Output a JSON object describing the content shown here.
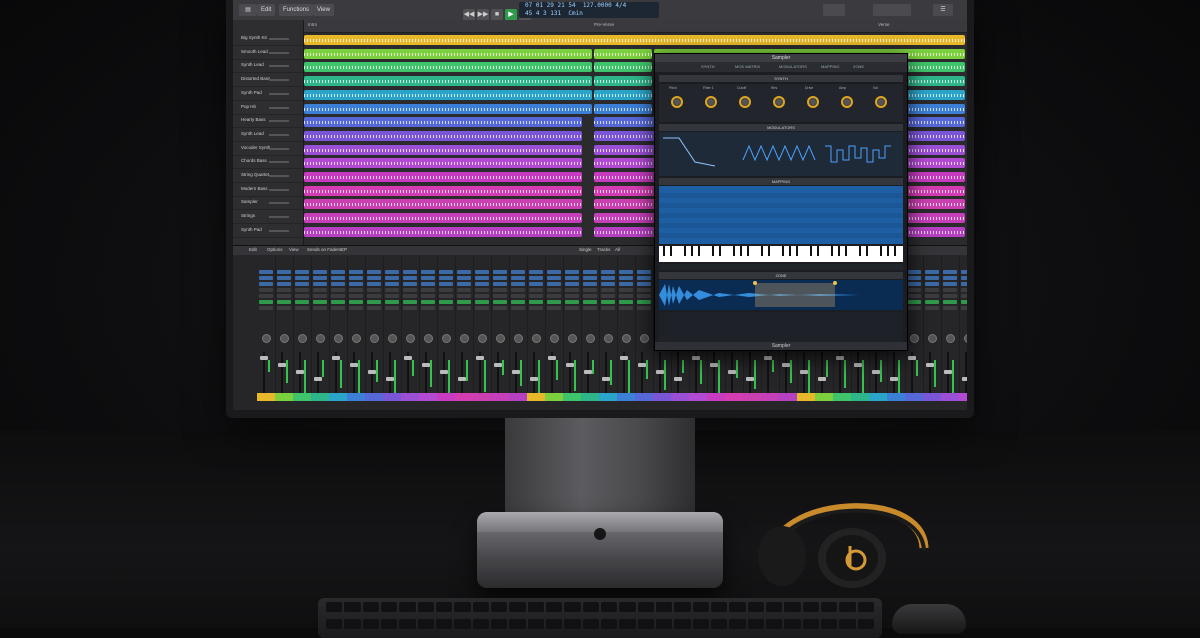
{
  "app": {
    "toolbar_left": [
      "Edit",
      "Functions",
      "View"
    ],
    "lcd_line1": "07 01 29 21 54",
    "lcd_line2": "45 4 3 131",
    "lcd_tempo": "127.0000",
    "lcd_sig": "4/4",
    "lcd_key": "Cmin",
    "transport_icons": [
      "rewind-icon",
      "forward-icon",
      "stop-icon",
      "play-icon",
      "record-icon",
      "cycle-icon"
    ]
  },
  "ruler": {
    "markers": [
      "Intro",
      "Pre-Verse",
      "Verse"
    ]
  },
  "tracks": [
    {
      "name": "Big Synth Kit",
      "color": "#e6b82a"
    },
    {
      "name": "Smooth Lead",
      "color": "#7ccf3d"
    },
    {
      "name": "Synth Lead",
      "color": "#3fc36b"
    },
    {
      "name": "Distorted Bass",
      "color": "#2fb58a"
    },
    {
      "name": "Synth Pad",
      "color": "#2aa4c9"
    },
    {
      "name": "Pop Hit",
      "color": "#3c7fd6"
    },
    {
      "name": "Hearty Bass",
      "color": "#5668d8"
    },
    {
      "name": "Synth Lead",
      "color": "#7a55d6"
    },
    {
      "name": "Vocoder Synth",
      "color": "#9b4fd4"
    },
    {
      "name": "Chords Bass",
      "color": "#b24ad3"
    },
    {
      "name": "String Quartet",
      "color": "#c63bc0"
    },
    {
      "name": "Modern Bass",
      "color": "#d43db2"
    },
    {
      "name": "Sampler",
      "color": "#cc3fb0"
    },
    {
      "name": "Strings",
      "color": "#c43fb8"
    },
    {
      "name": "Synth Pad",
      "color": "#b640c2"
    }
  ],
  "mixer": {
    "tabs": [
      "Edit",
      "Options",
      "View",
      "Sends on Faders",
      "EP"
    ],
    "right_tabs": [
      "Single",
      "Tracks",
      "All"
    ],
    "strip_colors": [
      "#e6b82a",
      "#7ccf3d",
      "#3fc36b",
      "#2fb58a",
      "#2aa4c9",
      "#3c7fd6",
      "#5668d8",
      "#7a55d6",
      "#9b4fd4",
      "#b24ad3",
      "#c63bc0",
      "#d43db2",
      "#cc3fb0",
      "#c43fb8",
      "#b640c2",
      "#e6b82a",
      "#7ccf3d",
      "#3fc36b",
      "#2fb58a",
      "#2aa4c9",
      "#3c7fd6",
      "#5668d8",
      "#7a55d6",
      "#9b4fd4",
      "#b24ad3",
      "#c63bc0",
      "#d43db2",
      "#cc3fb0",
      "#c43fb8",
      "#b640c2",
      "#e6b82a",
      "#7ccf3d",
      "#3fc36b",
      "#2fb58a",
      "#2aa4c9",
      "#3c7fd6",
      "#5668d8",
      "#7a55d6",
      "#9b4fd4",
      "#b24ad3"
    ]
  },
  "plugin": {
    "title": "Sampler",
    "tabs": [
      "SYNTH",
      "MOD MATRIX",
      "MODULATORS",
      "MAPPING",
      "ZONE"
    ],
    "synth_section": "SYNTH",
    "synth_knobs": [
      "Pitch",
      "Filter 1",
      "Cutoff",
      "Res",
      "Drive",
      "Amp",
      "Vol"
    ],
    "modulation_section": "MODULATORS",
    "mapping_section": "MAPPING",
    "zone_section": "ZONE",
    "footer": "Sampler"
  }
}
